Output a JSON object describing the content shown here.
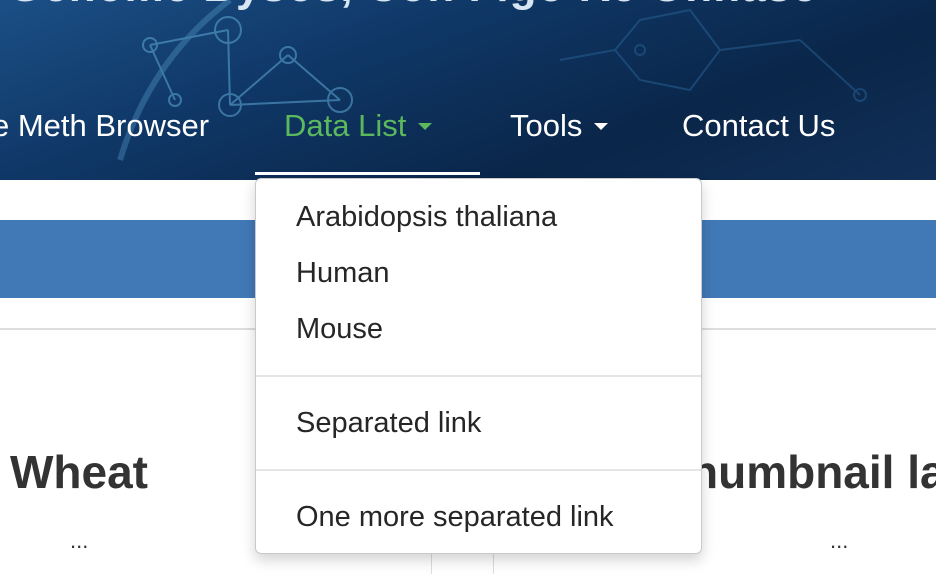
{
  "banner": {
    "title": "Genome Bysos, Con Figo Re Onnase"
  },
  "nav": {
    "items": [
      {
        "label": "e Meth Browser",
        "has_caret": false
      },
      {
        "label": "Data List",
        "has_caret": true,
        "active": true
      },
      {
        "label": "Tools",
        "has_caret": true
      },
      {
        "label": "Contact Us",
        "has_caret": false
      }
    ],
    "active_color": "#5cb85c"
  },
  "dropdown": {
    "items": [
      "Arabidopsis thaliana",
      "Human",
      "Mouse"
    ],
    "separated_link": "Separated link",
    "more_separated_link": "One more separated link"
  },
  "content": {
    "card_left_title": "Wheat",
    "card_left_more": "...",
    "card_right_title": "humbnail la",
    "card_right_more": "..."
  },
  "colors": {
    "banner": "#0f3766",
    "blue_bar": "#4179b7",
    "active_link": "#5cb85c"
  }
}
